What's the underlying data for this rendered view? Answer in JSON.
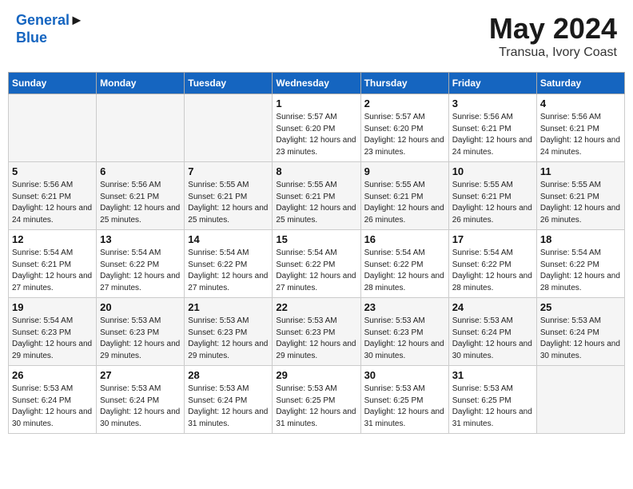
{
  "header": {
    "logo_line1": "General",
    "logo_line2": "Blue",
    "month": "May 2024",
    "location": "Transua, Ivory Coast"
  },
  "days_of_week": [
    "Sunday",
    "Monday",
    "Tuesday",
    "Wednesday",
    "Thursday",
    "Friday",
    "Saturday"
  ],
  "weeks": [
    [
      {
        "day": "",
        "sunrise": "",
        "sunset": "",
        "daylight": "",
        "empty": true
      },
      {
        "day": "",
        "sunrise": "",
        "sunset": "",
        "daylight": "",
        "empty": true
      },
      {
        "day": "",
        "sunrise": "",
        "sunset": "",
        "daylight": "",
        "empty": true
      },
      {
        "day": "1",
        "sunrise": "Sunrise: 5:57 AM",
        "sunset": "Sunset: 6:20 PM",
        "daylight": "Daylight: 12 hours and 23 minutes."
      },
      {
        "day": "2",
        "sunrise": "Sunrise: 5:57 AM",
        "sunset": "Sunset: 6:20 PM",
        "daylight": "Daylight: 12 hours and 23 minutes."
      },
      {
        "day": "3",
        "sunrise": "Sunrise: 5:56 AM",
        "sunset": "Sunset: 6:21 PM",
        "daylight": "Daylight: 12 hours and 24 minutes."
      },
      {
        "day": "4",
        "sunrise": "Sunrise: 5:56 AM",
        "sunset": "Sunset: 6:21 PM",
        "daylight": "Daylight: 12 hours and 24 minutes."
      }
    ],
    [
      {
        "day": "5",
        "sunrise": "Sunrise: 5:56 AM",
        "sunset": "Sunset: 6:21 PM",
        "daylight": "Daylight: 12 hours and 24 minutes."
      },
      {
        "day": "6",
        "sunrise": "Sunrise: 5:56 AM",
        "sunset": "Sunset: 6:21 PM",
        "daylight": "Daylight: 12 hours and 25 minutes."
      },
      {
        "day": "7",
        "sunrise": "Sunrise: 5:55 AM",
        "sunset": "Sunset: 6:21 PM",
        "daylight": "Daylight: 12 hours and 25 minutes."
      },
      {
        "day": "8",
        "sunrise": "Sunrise: 5:55 AM",
        "sunset": "Sunset: 6:21 PM",
        "daylight": "Daylight: 12 hours and 25 minutes."
      },
      {
        "day": "9",
        "sunrise": "Sunrise: 5:55 AM",
        "sunset": "Sunset: 6:21 PM",
        "daylight": "Daylight: 12 hours and 26 minutes."
      },
      {
        "day": "10",
        "sunrise": "Sunrise: 5:55 AM",
        "sunset": "Sunset: 6:21 PM",
        "daylight": "Daylight: 12 hours and 26 minutes."
      },
      {
        "day": "11",
        "sunrise": "Sunrise: 5:55 AM",
        "sunset": "Sunset: 6:21 PM",
        "daylight": "Daylight: 12 hours and 26 minutes."
      }
    ],
    [
      {
        "day": "12",
        "sunrise": "Sunrise: 5:54 AM",
        "sunset": "Sunset: 6:21 PM",
        "daylight": "Daylight: 12 hours and 27 minutes."
      },
      {
        "day": "13",
        "sunrise": "Sunrise: 5:54 AM",
        "sunset": "Sunset: 6:22 PM",
        "daylight": "Daylight: 12 hours and 27 minutes."
      },
      {
        "day": "14",
        "sunrise": "Sunrise: 5:54 AM",
        "sunset": "Sunset: 6:22 PM",
        "daylight": "Daylight: 12 hours and 27 minutes."
      },
      {
        "day": "15",
        "sunrise": "Sunrise: 5:54 AM",
        "sunset": "Sunset: 6:22 PM",
        "daylight": "Daylight: 12 hours and 27 minutes."
      },
      {
        "day": "16",
        "sunrise": "Sunrise: 5:54 AM",
        "sunset": "Sunset: 6:22 PM",
        "daylight": "Daylight: 12 hours and 28 minutes."
      },
      {
        "day": "17",
        "sunrise": "Sunrise: 5:54 AM",
        "sunset": "Sunset: 6:22 PM",
        "daylight": "Daylight: 12 hours and 28 minutes."
      },
      {
        "day": "18",
        "sunrise": "Sunrise: 5:54 AM",
        "sunset": "Sunset: 6:22 PM",
        "daylight": "Daylight: 12 hours and 28 minutes."
      }
    ],
    [
      {
        "day": "19",
        "sunrise": "Sunrise: 5:54 AM",
        "sunset": "Sunset: 6:23 PM",
        "daylight": "Daylight: 12 hours and 29 minutes."
      },
      {
        "day": "20",
        "sunrise": "Sunrise: 5:53 AM",
        "sunset": "Sunset: 6:23 PM",
        "daylight": "Daylight: 12 hours and 29 minutes."
      },
      {
        "day": "21",
        "sunrise": "Sunrise: 5:53 AM",
        "sunset": "Sunset: 6:23 PM",
        "daylight": "Daylight: 12 hours and 29 minutes."
      },
      {
        "day": "22",
        "sunrise": "Sunrise: 5:53 AM",
        "sunset": "Sunset: 6:23 PM",
        "daylight": "Daylight: 12 hours and 29 minutes."
      },
      {
        "day": "23",
        "sunrise": "Sunrise: 5:53 AM",
        "sunset": "Sunset: 6:23 PM",
        "daylight": "Daylight: 12 hours and 30 minutes."
      },
      {
        "day": "24",
        "sunrise": "Sunrise: 5:53 AM",
        "sunset": "Sunset: 6:24 PM",
        "daylight": "Daylight: 12 hours and 30 minutes."
      },
      {
        "day": "25",
        "sunrise": "Sunrise: 5:53 AM",
        "sunset": "Sunset: 6:24 PM",
        "daylight": "Daylight: 12 hours and 30 minutes."
      }
    ],
    [
      {
        "day": "26",
        "sunrise": "Sunrise: 5:53 AM",
        "sunset": "Sunset: 6:24 PM",
        "daylight": "Daylight: 12 hours and 30 minutes."
      },
      {
        "day": "27",
        "sunrise": "Sunrise: 5:53 AM",
        "sunset": "Sunset: 6:24 PM",
        "daylight": "Daylight: 12 hours and 30 minutes."
      },
      {
        "day": "28",
        "sunrise": "Sunrise: 5:53 AM",
        "sunset": "Sunset: 6:24 PM",
        "daylight": "Daylight: 12 hours and 31 minutes."
      },
      {
        "day": "29",
        "sunrise": "Sunrise: 5:53 AM",
        "sunset": "Sunset: 6:25 PM",
        "daylight": "Daylight: 12 hours and 31 minutes."
      },
      {
        "day": "30",
        "sunrise": "Sunrise: 5:53 AM",
        "sunset": "Sunset: 6:25 PM",
        "daylight": "Daylight: 12 hours and 31 minutes."
      },
      {
        "day": "31",
        "sunrise": "Sunrise: 5:53 AM",
        "sunset": "Sunset: 6:25 PM",
        "daylight": "Daylight: 12 hours and 31 minutes."
      },
      {
        "day": "",
        "sunrise": "",
        "sunset": "",
        "daylight": "",
        "empty": true
      }
    ]
  ]
}
